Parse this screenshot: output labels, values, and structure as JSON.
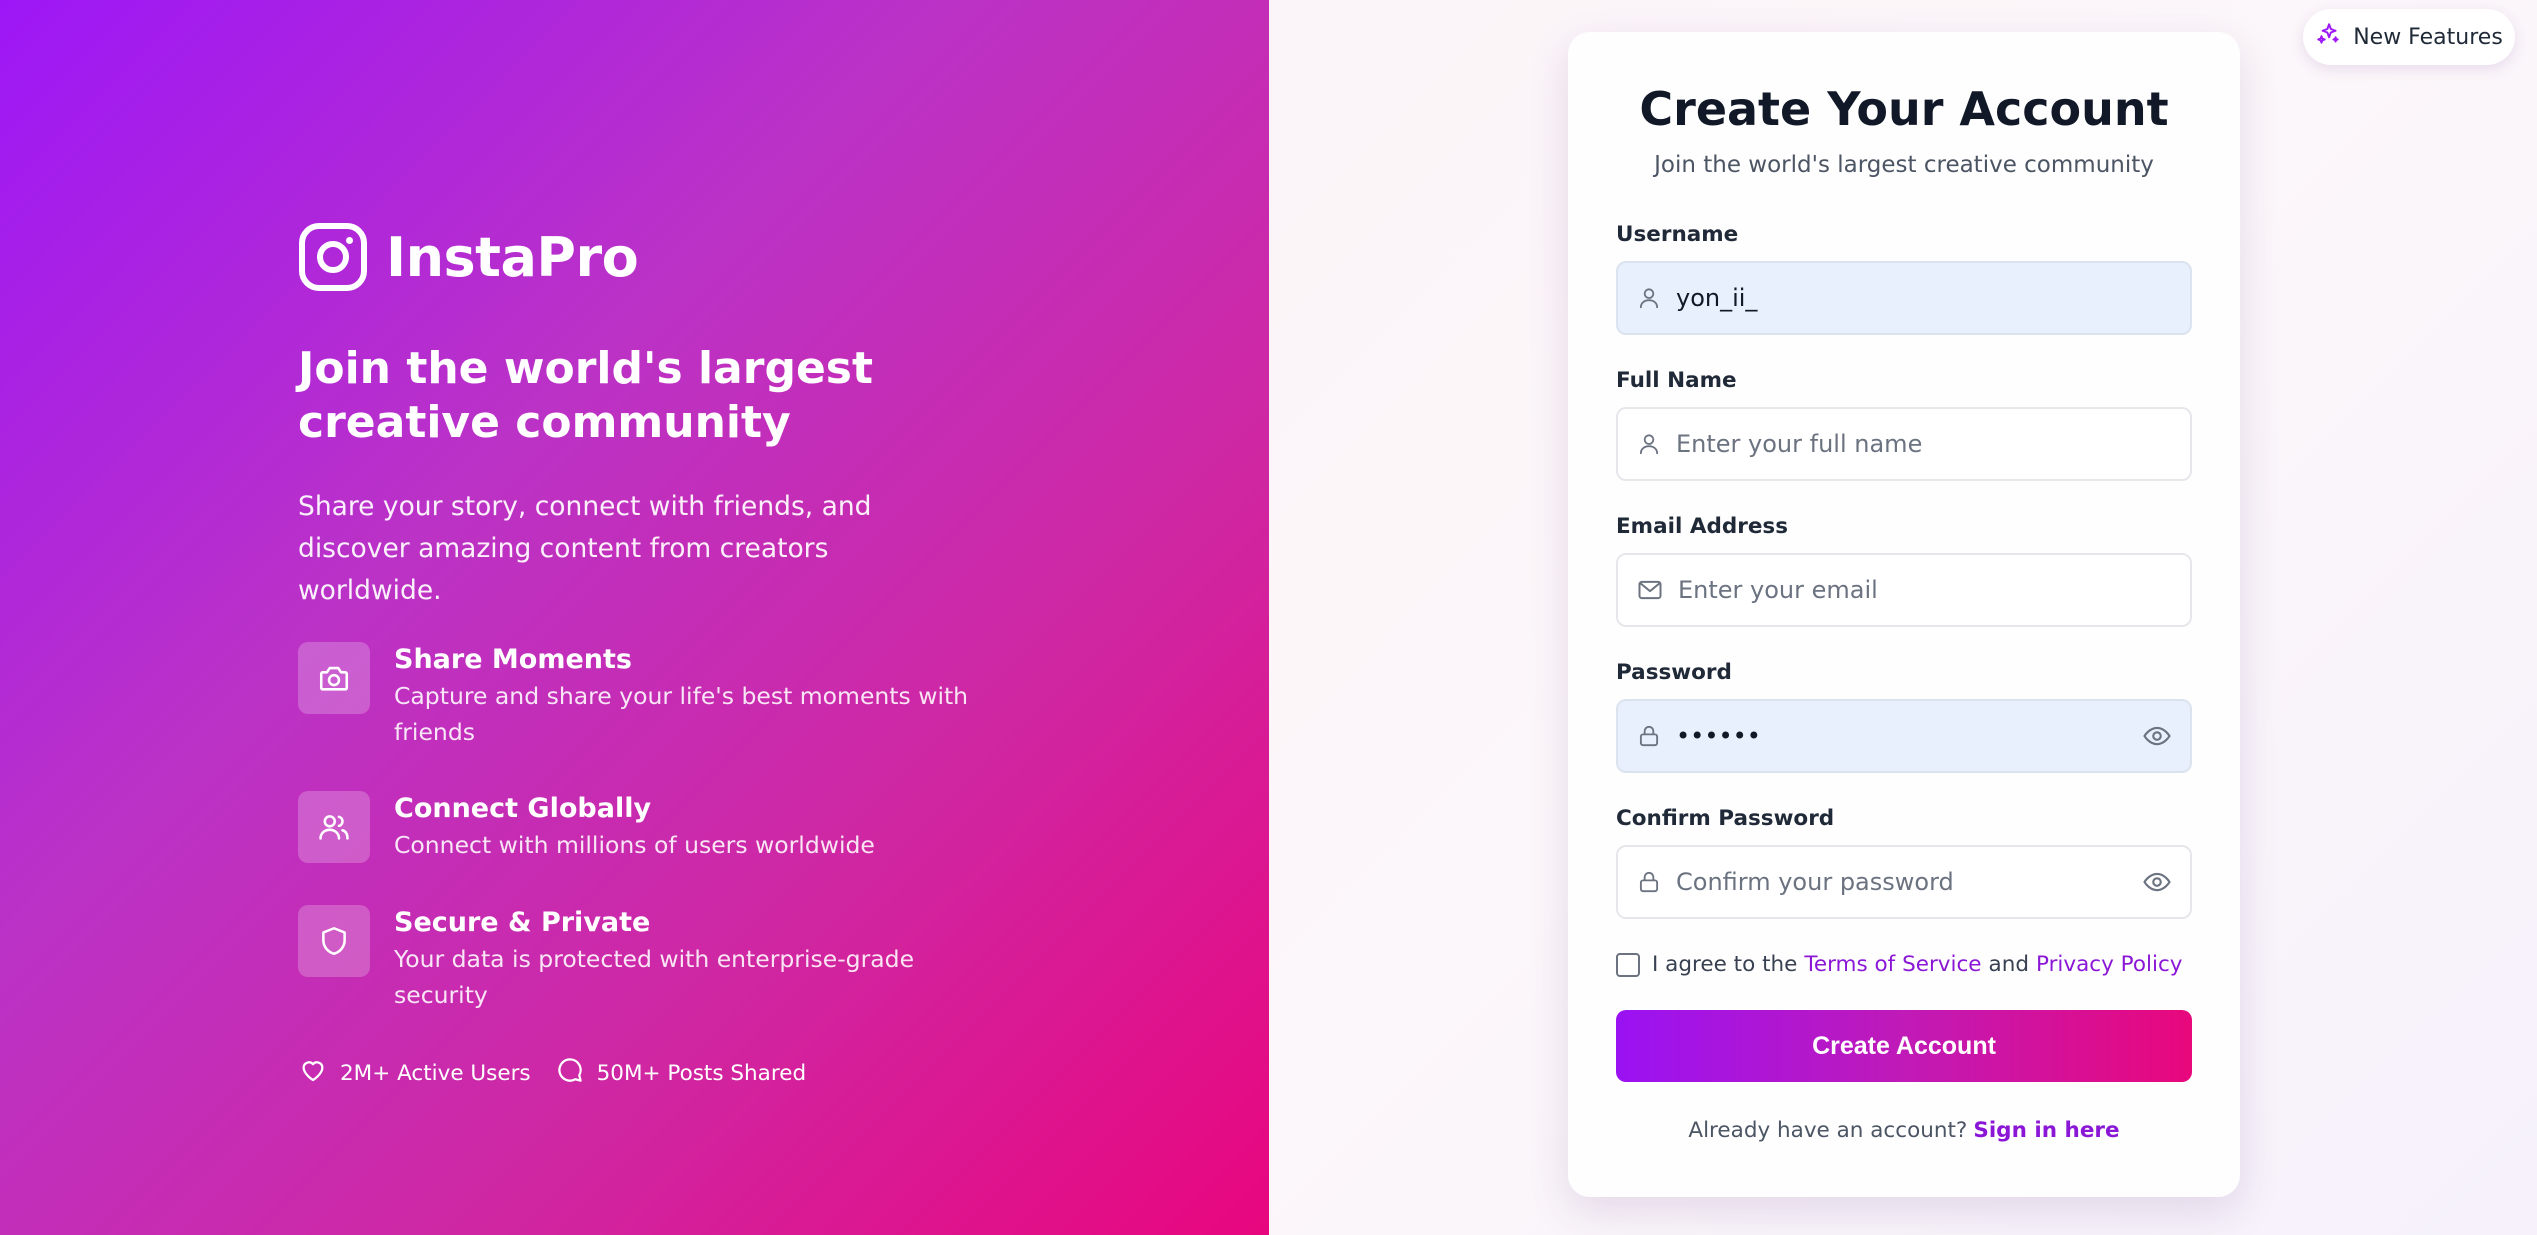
{
  "brand": {
    "name": "InstaPro"
  },
  "hero": {
    "title": "Join the world's largest creative community",
    "description": "Share your story, connect with friends, and discover amazing content from creators worldwide.",
    "features": [
      {
        "icon": "camera-icon",
        "title": "Share Moments",
        "desc": "Capture and share your life's best moments with friends"
      },
      {
        "icon": "users-icon",
        "title": "Connect Globally",
        "desc": "Connect with millions of users worldwide"
      },
      {
        "icon": "shield-icon",
        "title": "Secure & Private",
        "desc": "Your data is protected with enterprise-grade security"
      }
    ],
    "stats": [
      {
        "icon": "heart-icon",
        "label": "2M+ Active Users"
      },
      {
        "icon": "message-icon",
        "label": "50M+ Posts Shared"
      }
    ]
  },
  "new_features": {
    "label": "New Features",
    "icon": "sparkles-icon"
  },
  "form": {
    "title": "Create Your Account",
    "subtitle": "Join the world's largest creative community",
    "username": {
      "label": "Username",
      "value": "yon_ii_",
      "placeholder": ""
    },
    "full_name": {
      "label": "Full Name",
      "value": "",
      "placeholder": "Enter your full name"
    },
    "email": {
      "label": "Email Address",
      "value": "",
      "placeholder": "Enter your email"
    },
    "password": {
      "label": "Password",
      "value": "••••••"
    },
    "confirm_password": {
      "label": "Confirm Password",
      "value": "",
      "placeholder": "Confirm your password"
    },
    "agree": {
      "prefix": "I agree to the",
      "terms": "Terms of Service",
      "and": "and",
      "privacy": "Privacy Policy"
    },
    "submit_label": "Create Account",
    "signin": {
      "prompt": "Already have an account?",
      "link": "Sign in here"
    }
  },
  "colors": {
    "accent_purple": "#9d17f7",
    "accent_pink": "#e8067e",
    "link": "#8b17d6",
    "filled_field_bg": "#e8f0fd"
  }
}
